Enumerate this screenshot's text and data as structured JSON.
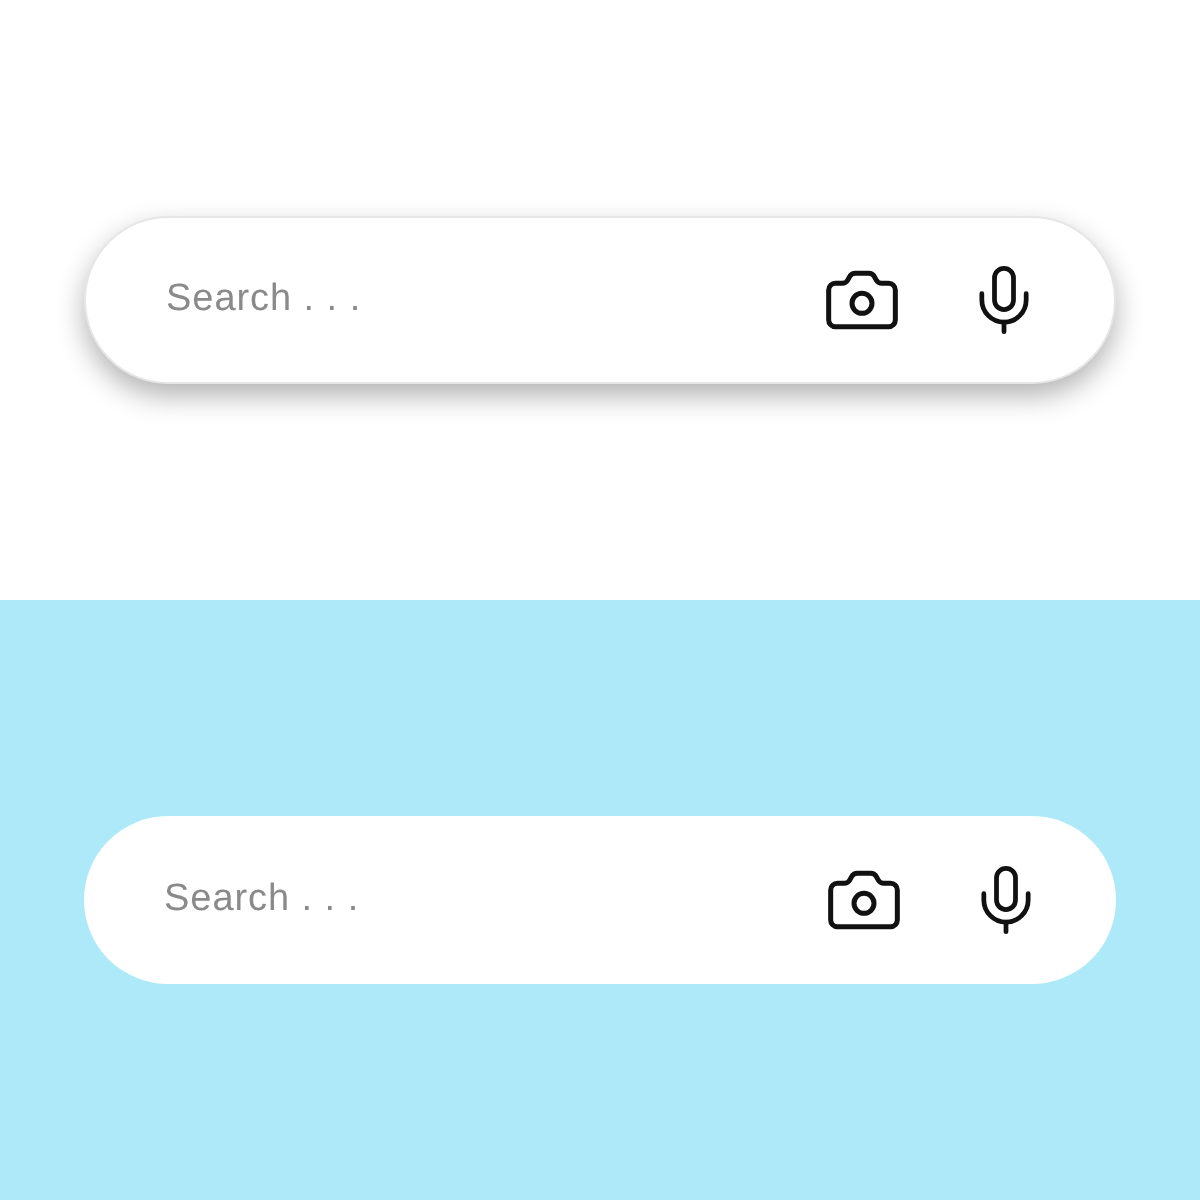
{
  "sections": [
    {
      "kind": "plain",
      "search_bar": {
        "placeholder": "Search . . .",
        "shadow": true
      }
    },
    {
      "kind": "tinted",
      "search_bar": {
        "placeholder": "Search . . .",
        "shadow": false
      }
    }
  ]
}
